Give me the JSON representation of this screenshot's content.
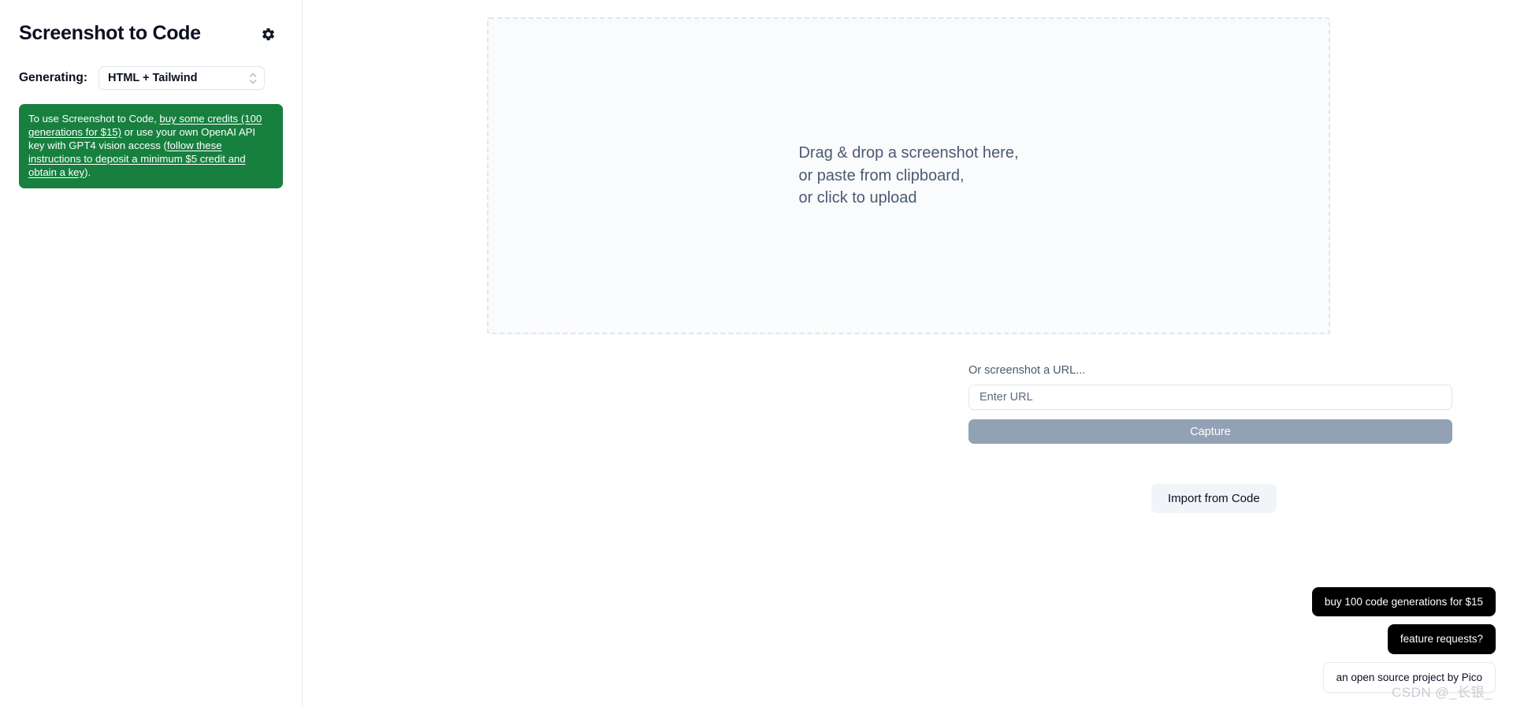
{
  "sidebar": {
    "title": "Screenshot to Code",
    "settings_icon": "gear-icon",
    "generating_label": "Generating:",
    "stack_value": "HTML + Tailwind",
    "stack_options": [
      "HTML + Tailwind"
    ],
    "notice": {
      "part1": "To use Screenshot to Code, ",
      "link1": "buy some credits (100 generations for $15)",
      "part2": " or use your own OpenAI API key with GPT4 vision access (",
      "link2": "follow these instructions to deposit a minimum $5 credit and obtain a key",
      "part3": ").",
      "background_color": "#17803f",
      "text_color": "#ffffff"
    }
  },
  "main": {
    "dropzone": {
      "line1": "Drag & drop a screenshot here,",
      "line2": "or paste from clipboard,",
      "line3": "or click to upload"
    },
    "url_section": {
      "label": "Or screenshot a URL...",
      "input_value": "",
      "input_placeholder": "Enter URL",
      "capture_label": "Capture",
      "capture_color": "#93a1b5"
    },
    "import_label": "Import from Code"
  },
  "badges": [
    {
      "label": "buy 100 code generations for $15",
      "style": "dark"
    },
    {
      "label": "feature requests?",
      "style": "dark"
    },
    {
      "label": "an open source project by Pico",
      "style": "light"
    }
  ],
  "watermark": "CSDN @_长银_"
}
